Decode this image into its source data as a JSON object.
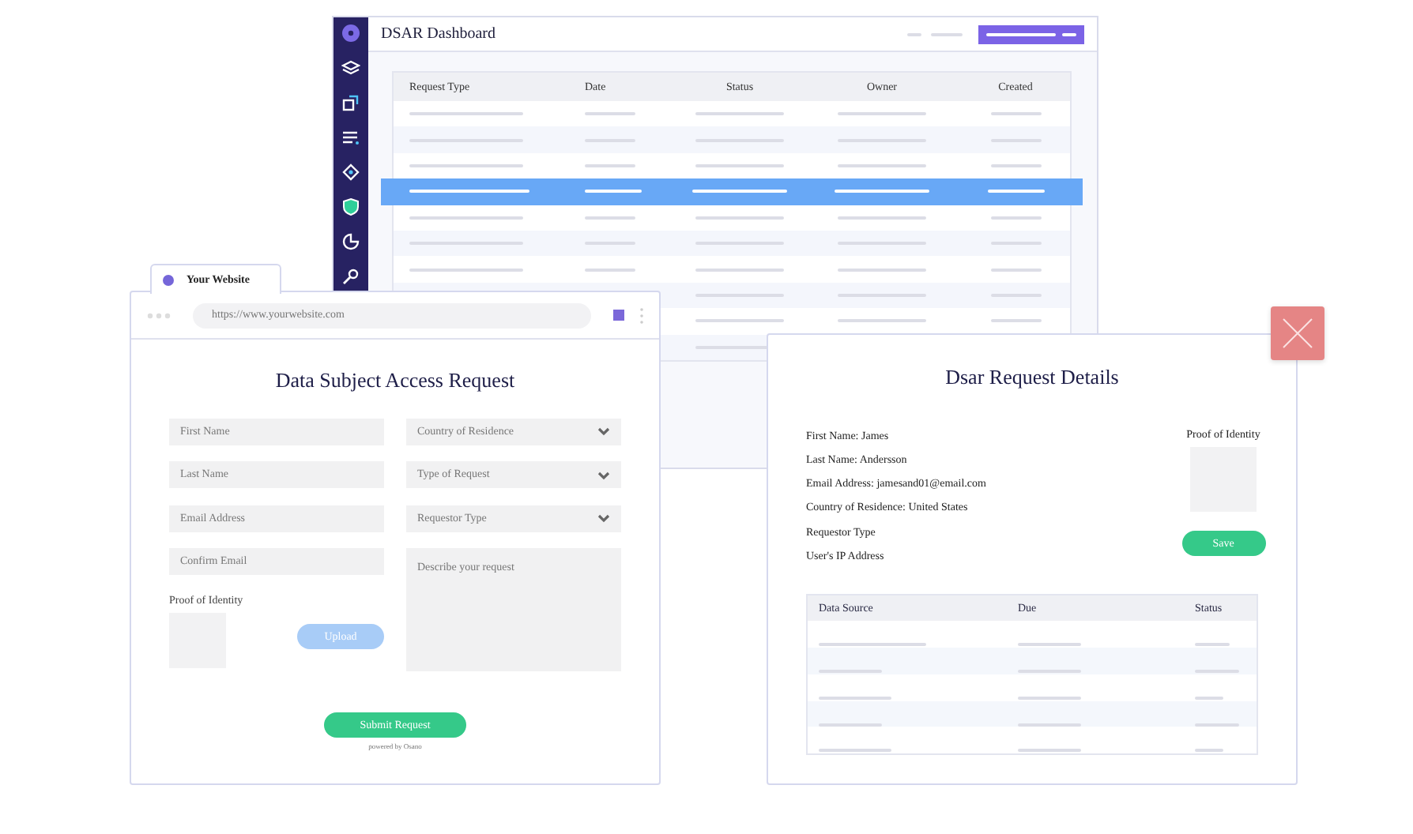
{
  "dashboard": {
    "title": "DSAR Dashboard",
    "columns": [
      "Request Type",
      "Date",
      "Status",
      "Owner",
      "Created"
    ],
    "rows": [
      {
        "kind": "placeholder",
        "selected": false
      },
      {
        "kind": "placeholder",
        "selected": false
      },
      {
        "kind": "placeholder",
        "selected": false
      },
      {
        "kind": "placeholder",
        "selected": true
      },
      {
        "kind": "placeholder",
        "selected": false
      },
      {
        "kind": "placeholder",
        "selected": false
      },
      {
        "kind": "placeholder",
        "selected": false
      },
      {
        "kind": "placeholder",
        "selected": false
      },
      {
        "kind": "placeholder",
        "selected": false
      },
      {
        "kind": "placeholder",
        "selected": false
      }
    ]
  },
  "website": {
    "tab": "Your Website",
    "url": "https://www.yourwebsite.com",
    "title": "Data Subject Access Request",
    "fields": [
      {
        "kind": "input",
        "placeholder": "First Name"
      },
      {
        "kind": "select",
        "placeholder": "Country of Residence"
      },
      {
        "kind": "input",
        "placeholder": "Last Name"
      },
      {
        "kind": "select",
        "placeholder": "Type of Request"
      },
      {
        "kind": "input",
        "placeholder": "Email Address"
      },
      {
        "kind": "select",
        "placeholder": "Requestor Type"
      },
      {
        "kind": "input",
        "placeholder": "Confirm Email"
      },
      {
        "kind": "textarea",
        "placeholder": "Describe your request"
      }
    ],
    "proof_label": "Proof of Identity",
    "upload": "Upload",
    "submit": "Submit Request",
    "footer": "powered by Osano"
  },
  "details": {
    "title": "Dsar Request Details",
    "fields": [
      "First Name: James",
      "Last Name: Andersson",
      "Email Address: jamesand01@email.com",
      "Country of Residence: United States",
      "Requestor Type",
      "User's IP Address"
    ],
    "proof_label": "Proof of Identity",
    "save": "Save",
    "columns": [
      "Data Source",
      "Due",
      "Status"
    ],
    "rows": [
      {
        "kind": "placeholder"
      },
      {
        "kind": "placeholder"
      },
      {
        "kind": "placeholder"
      },
      {
        "kind": "placeholder"
      },
      {
        "kind": "placeholder"
      }
    ]
  }
}
